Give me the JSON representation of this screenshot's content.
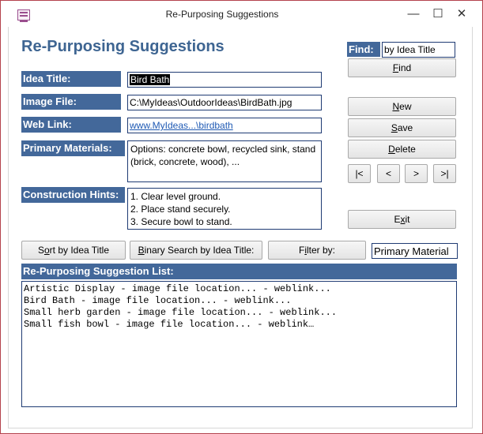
{
  "window": {
    "title": "Re-Purposing Suggestions",
    "minimize_glyph": "—",
    "maximize_glyph": "☐",
    "close_glyph": "✕"
  },
  "form": {
    "heading": "Re-Purposing Suggestions",
    "fields": {
      "idea_title": {
        "label": "Idea Title:",
        "value": "Bird Bath"
      },
      "image_file": {
        "label": "Image File:",
        "value": "C:\\MyIdeas\\OutdoorIdeas\\BirdBath.jpg"
      },
      "web_link": {
        "label": "Web Link:",
        "value": "www.MyIdeas...\\birdbath"
      },
      "primary_materials": {
        "label": "Primary Materials:",
        "value": "Options: concrete bowl, recycled sink, stand (brick, concrete, wood), ..."
      },
      "construction_hints": {
        "label": "Construction Hints:",
        "lines": [
          "1. Clear level ground.",
          "2. Place stand securely.",
          "3. Secure bowl to stand."
        ]
      }
    },
    "find": {
      "label": "Find:",
      "value": "by Idea Title",
      "button_pre": "",
      "button_key": "F",
      "button_post": "ind"
    },
    "actions": {
      "new": {
        "key": "N",
        "rest": "ew"
      },
      "save": {
        "key": "S",
        "rest": "ave"
      },
      "delete": {
        "key": "D",
        "rest": "elete"
      },
      "exit": {
        "pre": "E",
        "key": "x",
        "rest": "it"
      }
    },
    "navigation": {
      "first": "|<",
      "prev": "<",
      "next": ">",
      "last": ">|"
    },
    "sort_button": {
      "pre": "S",
      "key": "o",
      "rest": "rt by Idea Title"
    },
    "binary_search_button": {
      "key": "B",
      "rest": "inary Search by Idea Title:"
    },
    "filter_button": {
      "pre": "F",
      "key": "i",
      "rest": "lter by:"
    },
    "filter_value": "Primary Material",
    "list": {
      "header": "Re-Purposing Suggestion List:",
      "items": [
        "Artistic Display - image file location... - weblink...",
        "Bird Bath - image file location... - weblink...",
        "Small herb garden - image file location... - weblink...",
        "Small fish bowl - image file location... - weblink…"
      ]
    }
  }
}
